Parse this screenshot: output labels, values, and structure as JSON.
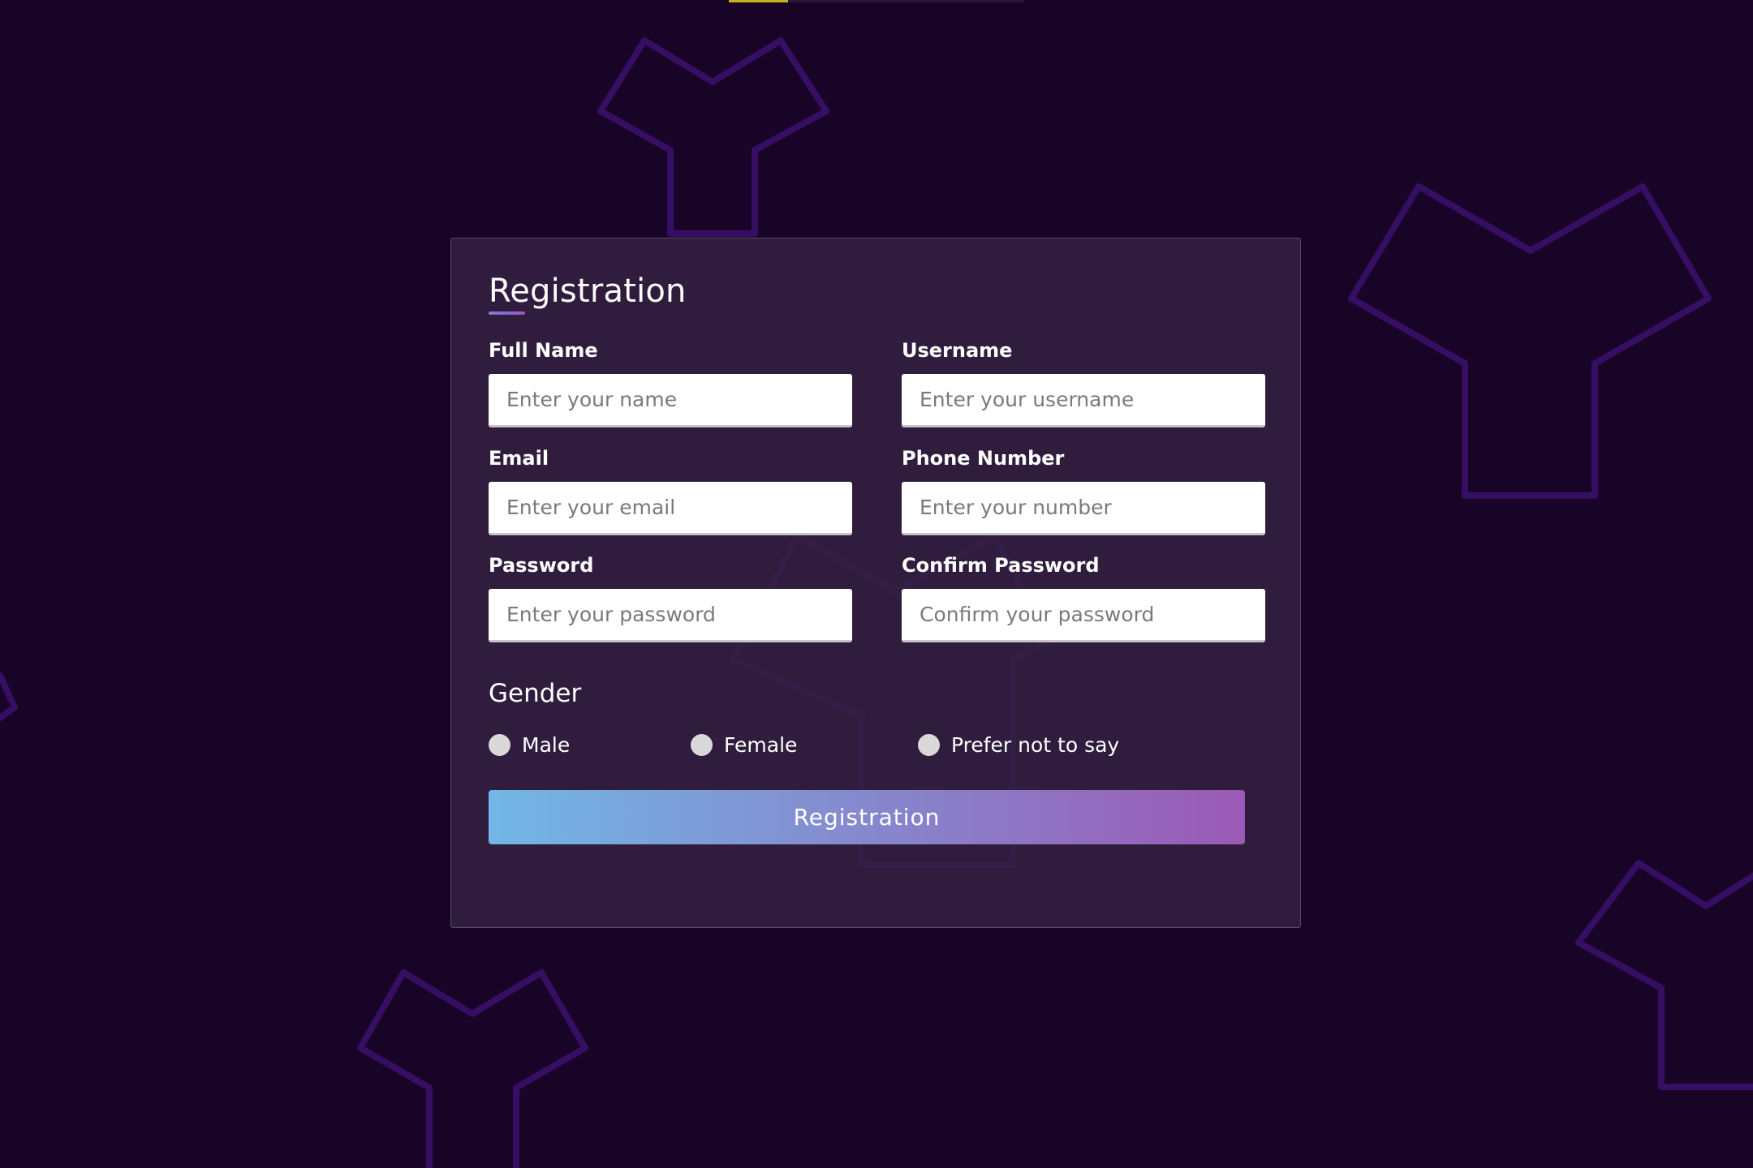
{
  "top_progress": {
    "value_fraction": 0.2
  },
  "form": {
    "title": "Registration",
    "fields": [
      {
        "label": "Full Name",
        "placeholder": "Enter your name"
      },
      {
        "label": "Username",
        "placeholder": "Enter your username"
      },
      {
        "label": "Email",
        "placeholder": "Enter your email"
      },
      {
        "label": "Phone Number",
        "placeholder": "Enter your number"
      },
      {
        "label": "Password",
        "placeholder": "Enter your password"
      },
      {
        "label": "Confirm Password",
        "placeholder": "Confirm your password"
      }
    ],
    "gender": {
      "title": "Gender",
      "options": [
        "Male",
        "Female",
        "Prefer not to say"
      ]
    },
    "submit_label": "Registration"
  },
  "colors": {
    "background": "#170426",
    "card_background": "#342142",
    "shape_stroke": "#3a0f6b",
    "gradient_start": "#71b7e6",
    "gradient_end": "#9b59b6",
    "progress_fill": "#c9b21f"
  }
}
